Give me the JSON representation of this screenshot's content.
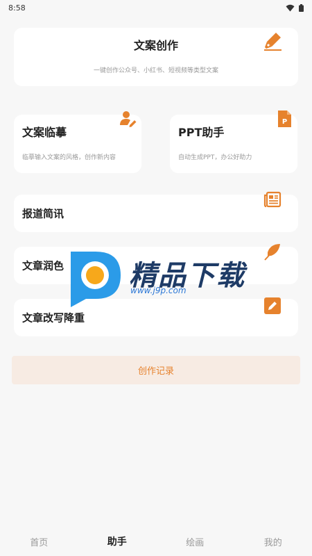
{
  "status": {
    "time": "8:58"
  },
  "cards": {
    "copywriting": {
      "title": "文案创作",
      "subtitle": "一键创作公众号、小红书、短视频等类型文案",
      "icon": "fountain-pen-icon"
    },
    "imitate": {
      "title": "文案临摹",
      "subtitle": "临摹输入文案的风格，创作新内容",
      "icon": "user-edit-icon"
    },
    "ppt": {
      "title": "PPT助手",
      "subtitle": "自动生成PPT，办公好助力",
      "icon": "ppt-file-icon"
    },
    "news": {
      "title": "报道简讯",
      "icon": "newspaper-icon"
    },
    "polish": {
      "title": "文章润色",
      "icon": "feather-icon"
    },
    "rewrite": {
      "title": "文章改写降重",
      "icon": "edit-box-icon"
    }
  },
  "history_button": "创作记录",
  "watermark": {
    "logo_text": "精品下载",
    "url": "www.j9p.com"
  },
  "tabs": [
    "首页",
    "助手",
    "绘画",
    "我的"
  ],
  "active_tab": "助手",
  "colors": {
    "accent": "#e6822d",
    "history_bg": "#f7ebe3"
  }
}
